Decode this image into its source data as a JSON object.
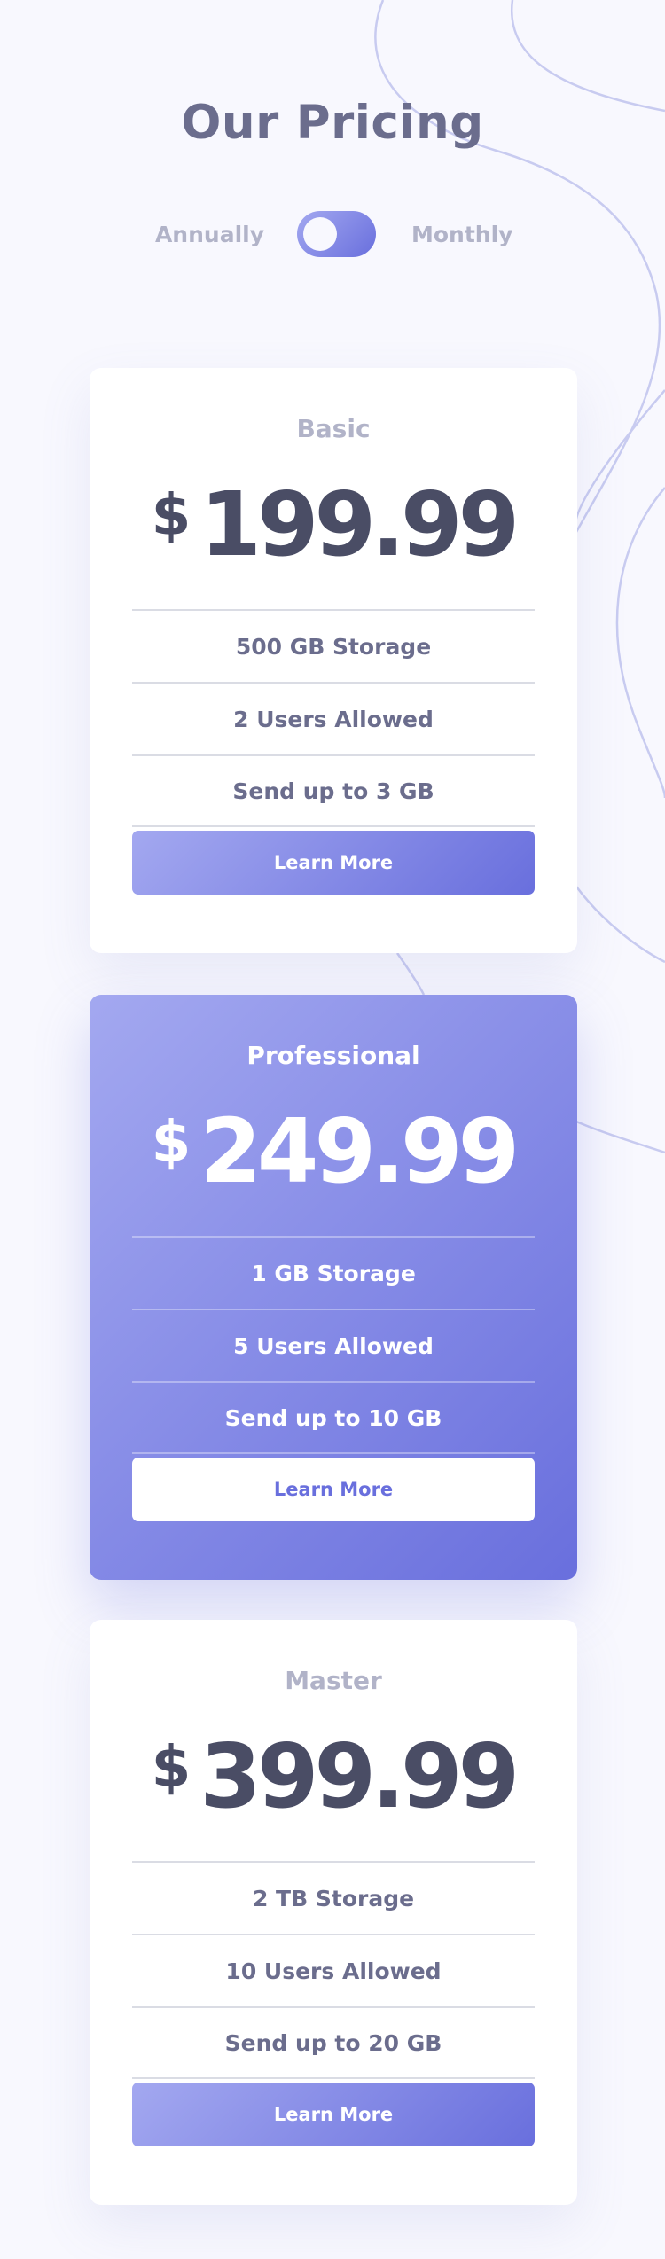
{
  "header": {
    "title": "Our Pricing"
  },
  "billing_toggle": {
    "left_label": "Annually",
    "right_label": "Monthly"
  },
  "plans": [
    {
      "name": "Basic",
      "currency": "$",
      "price": "199.99",
      "features": [
        "500 GB Storage",
        "2 Users Allowed",
        "Send up to 3 GB"
      ],
      "button_label": "Learn More"
    },
    {
      "name": "Professional",
      "currency": "$",
      "price": "249.99",
      "features": [
        "1 GB Storage",
        "5 Users Allowed",
        "Send up to 10 GB"
      ],
      "button_label": "Learn More"
    },
    {
      "name": "Master",
      "currency": "$",
      "price": "399.99",
      "features": [
        "2 TB Storage",
        "10 Users Allowed",
        "Send up to 20 GB"
      ],
      "button_label": "Learn More"
    }
  ],
  "colors": {
    "accent_start": "#a3a8f0",
    "accent_end": "#696fdd",
    "title_text": "#6b6d8d",
    "price_text": "#4a4d65",
    "muted_text": "#b1b3c8",
    "background": "#f8f8fe"
  }
}
